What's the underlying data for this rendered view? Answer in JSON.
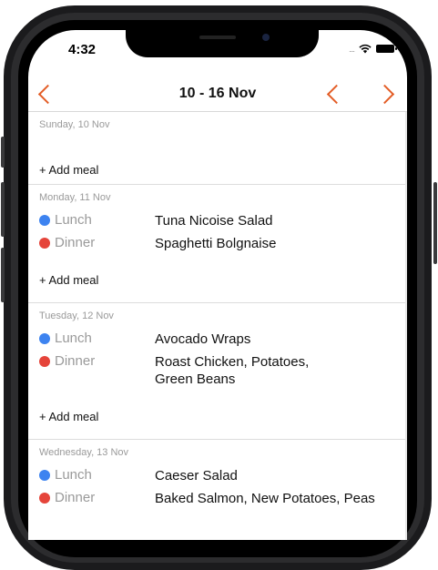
{
  "status_bar": {
    "time": "4:32",
    "signal": "....",
    "wifi_icon": "wifi-icon",
    "battery_icon": "battery-icon"
  },
  "nav": {
    "title": "10 - 16 Nov",
    "back_icon": "chevron-left-icon",
    "prev_icon": "chevron-left-icon",
    "next_icon": "chevron-right-icon",
    "accent_color": "#e35d26"
  },
  "days": [
    {
      "header": "Sunday, 10 Nov",
      "meals": [],
      "add_label": "+ Add meal"
    },
    {
      "header": "Monday, 11 Nov",
      "meals": [
        {
          "type": "Lunch",
          "name": "Tuna Nicoise Salad",
          "color": "#3d83f0"
        },
        {
          "type": "Dinner",
          "name": "Spaghetti Bolgnaise",
          "color": "#e5443a"
        }
      ],
      "add_label": "+ Add meal"
    },
    {
      "header": "Tuesday, 12 Nov",
      "meals": [
        {
          "type": "Lunch",
          "name": "Avocado Wraps",
          "color": "#3d83f0"
        },
        {
          "type": "Dinner",
          "name": "Roast Chicken, Potatoes, Green Beans",
          "color": "#e5443a"
        }
      ],
      "add_label": "+ Add meal"
    },
    {
      "header": "Wednesday, 13 Nov",
      "meals": [
        {
          "type": "Lunch",
          "name": "Caeser Salad",
          "color": "#3d83f0"
        },
        {
          "type": "Dinner",
          "name": "Baked Salmon, New Potatoes, Peas",
          "color": "#e5443a"
        }
      ]
    }
  ]
}
